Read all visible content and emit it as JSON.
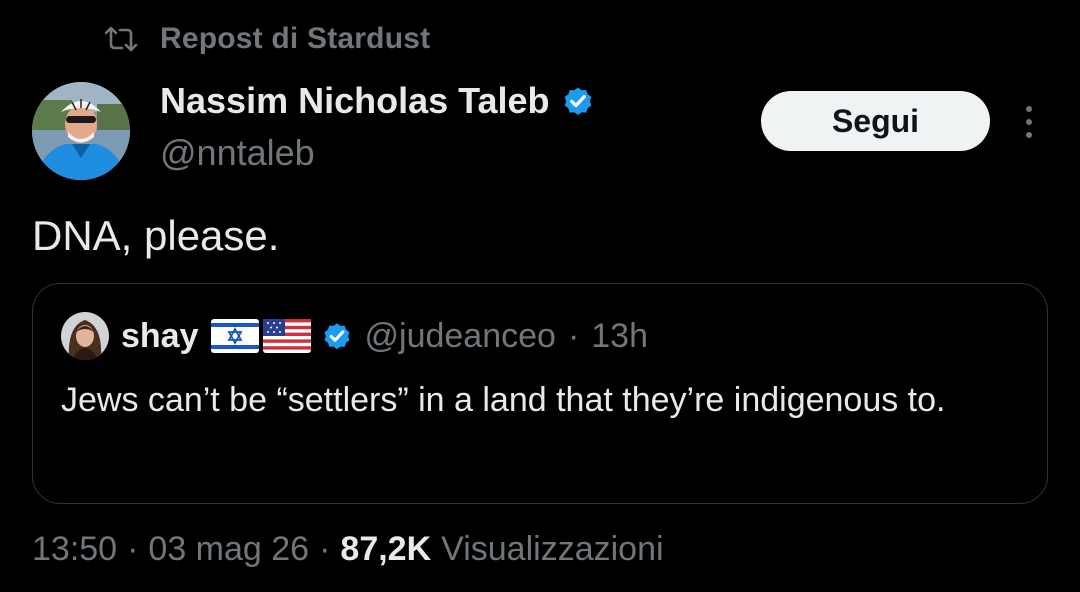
{
  "repost": {
    "icon": "repost-icon",
    "label": "Repost di Stardust"
  },
  "author": {
    "display_name": "Nassim Nicholas Taleb",
    "handle": "@nntaleb",
    "verified": true,
    "avatar_icon": "cyclist-avatar"
  },
  "actions": {
    "follow_label": "Segui",
    "more_icon": "more-vertical-icon"
  },
  "tweet": {
    "text": "DNA, please."
  },
  "quote": {
    "display_name": "shay",
    "flags": [
      "flag-israel-icon",
      "flag-usa-icon"
    ],
    "verified": true,
    "handle": "@judeanceo",
    "separator": "·",
    "time": "13h",
    "text": "Jews can’t be “settlers” in a land that they’re indigenous to."
  },
  "meta": {
    "time": "13:50",
    "sep1": "·",
    "date": "03 mag 26",
    "sep2": "·",
    "views_count": "87,2K",
    "views_label": "Visualizzazioni"
  },
  "colors": {
    "background": "#000000",
    "text_primary": "#e7e9ea",
    "text_secondary": "#71767b",
    "verified_blue": "#1d9bf0",
    "border": "#2f3336",
    "button_bg": "#eff3f4"
  }
}
